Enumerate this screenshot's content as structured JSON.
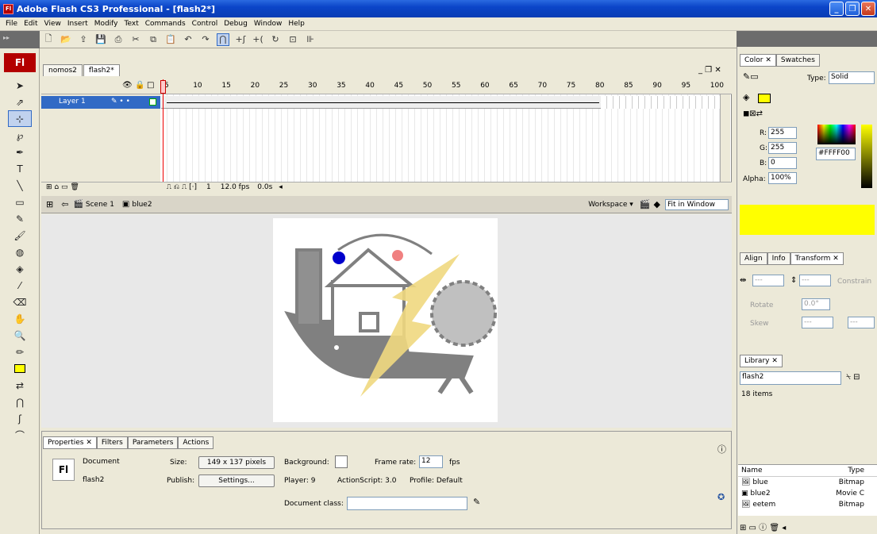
{
  "window": {
    "title": "Adobe Flash CS3 Professional - [flash2*]"
  },
  "menu": [
    "File",
    "Edit",
    "View",
    "Insert",
    "Modify",
    "Text",
    "Commands",
    "Control",
    "Debug",
    "Window",
    "Help"
  ],
  "doc_tabs": [
    "nomos2",
    "flash2*"
  ],
  "timeline": {
    "layer_name": "Layer 1",
    "frame_numbers": [
      "5",
      "10",
      "15",
      "20",
      "25",
      "30",
      "35",
      "40",
      "45",
      "50",
      "55",
      "60",
      "65",
      "70",
      "75",
      "80",
      "85",
      "90",
      "95",
      "100"
    ],
    "current_frame": "1",
    "fps": "12.0 fps",
    "time": "0.0s"
  },
  "scene": {
    "scene_name": "Scene 1",
    "symbol_name": "blue2",
    "workspace": "Workspace ▾",
    "zoom": "Fit in Window"
  },
  "properties": {
    "tabs": [
      "Properties",
      "Filters",
      "Parameters",
      "Actions"
    ],
    "doc_label": "Document",
    "doc_name": "flash2",
    "size_label": "Size:",
    "size_value": "149 x 137 pixels",
    "publish_label": "Publish:",
    "settings_btn": "Settings...",
    "background_label": "Background:",
    "framerate_label": "Frame rate:",
    "framerate_value": "12",
    "fps_unit": "fps",
    "player": "Player: 9",
    "actionscript": "ActionScript: 3.0",
    "profile": "Profile: Default",
    "docclass_label": "Document class:"
  },
  "color_panel": {
    "tabs": [
      "Color",
      "Swatches"
    ],
    "type_label": "Type:",
    "type_value": "Solid",
    "r_label": "R:",
    "r": "255",
    "g_label": "G:",
    "g": "255",
    "b_label": "B:",
    "b": "0",
    "alpha_label": "Alpha:",
    "alpha": "100%",
    "hex": "#FFFF00",
    "swatch": "#ffff00"
  },
  "transform_panel": {
    "tabs": [
      "Align",
      "Info",
      "Transform"
    ],
    "w": "---",
    "h": "---",
    "constrain": "Constrain",
    "rotate": "Rotate",
    "rotate_val": "0.0°",
    "skew": "Skew",
    "skew_a": "---",
    "skew_b": "---"
  },
  "library": {
    "tab": "Library",
    "doc": "flash2",
    "count": "18 items",
    "col_name": "Name",
    "col_type": "Type",
    "items": [
      {
        "name": "blue",
        "type": "Bitmap"
      },
      {
        "name": "blue2",
        "type": "Movie C"
      },
      {
        "name": "eetem",
        "type": "Bitmap"
      }
    ]
  }
}
